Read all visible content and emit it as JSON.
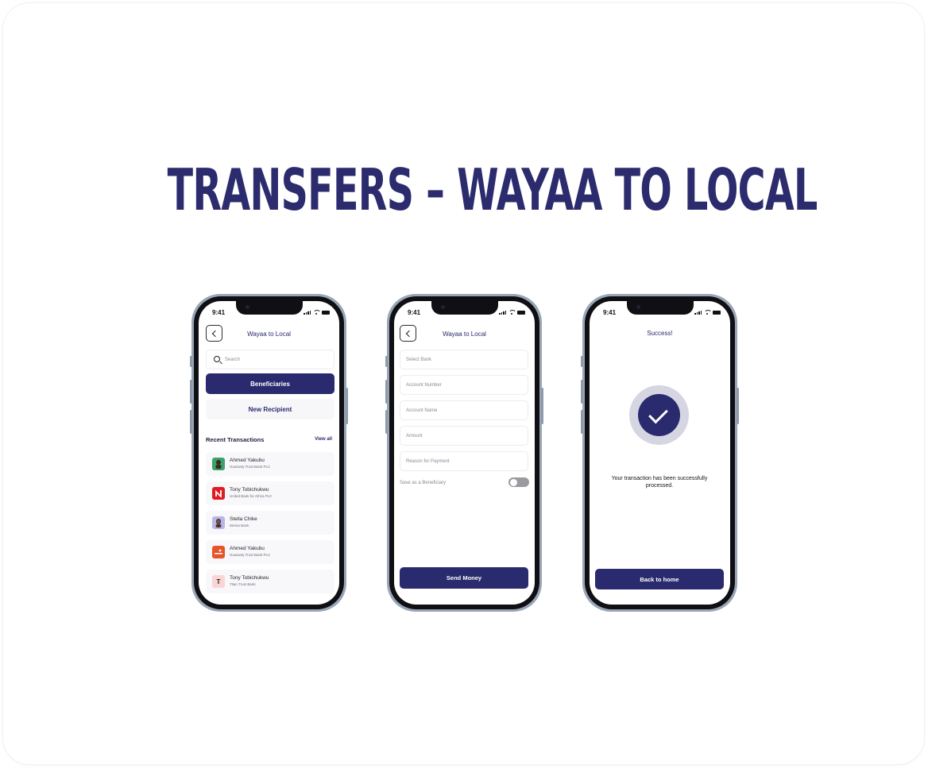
{
  "headline": "TRANSFERS – WAYAA TO LOCAL",
  "colors": {
    "primary": "#2a2a6e",
    "frame": "#9aa6b6",
    "background": "#ffffff"
  },
  "status_time": "9:41",
  "screen1": {
    "title": "Wayaa to Local",
    "search_placeholder": "Search",
    "beneficiaries_label": "Beneficiaries",
    "new_recipient_label": "New Recipient",
    "recent_label": "Recent Transactions",
    "view_all_label": "View all",
    "transactions": [
      {
        "name": "Ahmed Yakubu",
        "bank": "Guaranty Trust Bank PLC",
        "logo": "avatar-icon",
        "color": "#3aa36a"
      },
      {
        "name": "Tony Tobichukwu",
        "bank": "United Bank for Africa PLC",
        "logo": "uba-logo-icon",
        "color": "#e21b23"
      },
      {
        "name": "Stella Chike",
        "bank": "Wema Bank",
        "logo": "avatar-icon",
        "color": "#b9b5e8"
      },
      {
        "name": "Ahmed Yakubu",
        "bank": "Guaranty Trust Bank PLC",
        "logo": "gtb-logo-icon",
        "color": "#e8542a"
      },
      {
        "name": "Tony Tobichukwu",
        "bank": "Titan Trust Bank",
        "logo": "letter-t-icon",
        "letter": "T",
        "color": "#fbd4d6"
      }
    ]
  },
  "screen2": {
    "title": "Wayaa to Local",
    "fields": [
      "Select Bank",
      "Account Number",
      "Account Name",
      "Amount",
      "Reason for Payment"
    ],
    "save_beneficiary_label": "Save as a Beneficiary",
    "save_beneficiary_on": false,
    "send_label": "Send Money"
  },
  "screen3": {
    "title": "Success!",
    "message": "Your transaction has been successfully processed.",
    "back_label": "Back to home"
  }
}
